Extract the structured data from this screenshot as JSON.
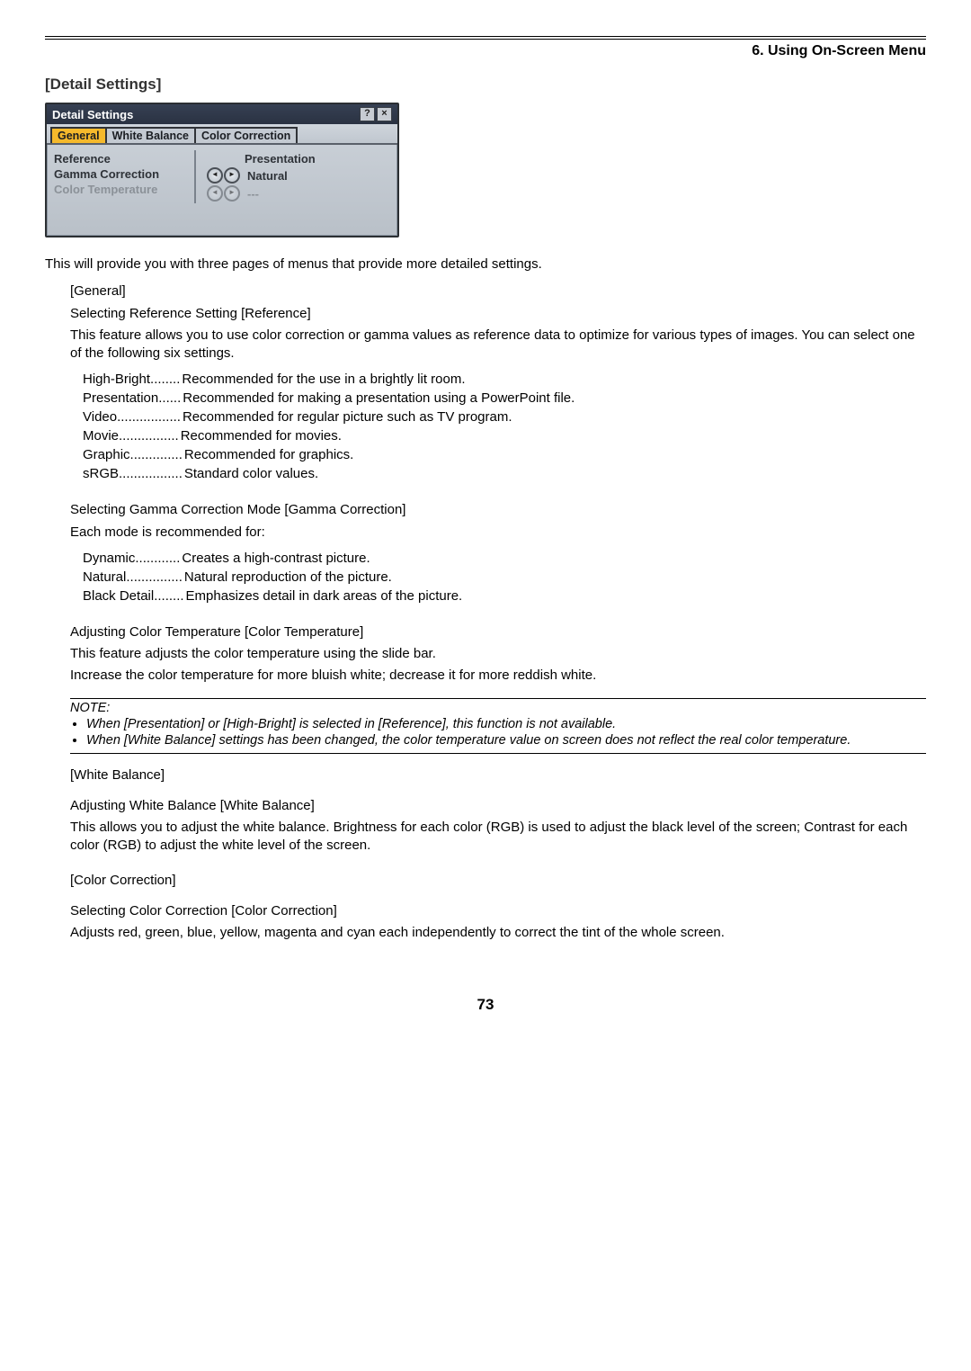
{
  "chapter": "6. Using On-Screen Menu",
  "section_title": "[Detail Settings]",
  "dialog": {
    "title": "Detail Settings",
    "tabs": {
      "general": "General",
      "white_balance": "White Balance",
      "color_correction": "Color Correction"
    },
    "rows": {
      "reference_label": "Reference",
      "reference_value": "Presentation",
      "gamma_label": "Gamma Correction",
      "gamma_value": "Natural",
      "ct_label": "Color Temperature",
      "ct_value": "---"
    }
  },
  "intro": "This will provide you with three pages of menus that provide more detailed settings.",
  "general": {
    "heading": "[General]",
    "ref_title": "Selecting Reference Setting [Reference]",
    "ref_desc": "This feature allows you to use color correction or gamma values as reference data to optimize for various types of images. You can select one of the following six settings.",
    "items": [
      {
        "term": "High-Bright",
        "dots": " ........ ",
        "desc": "Recommended for the use in a brightly lit room."
      },
      {
        "term": "Presentation",
        "dots": " ...... ",
        "desc": "Recommended for making a presentation using a PowerPoint file."
      },
      {
        "term": "Video",
        "dots": " ................. ",
        "desc": "Recommended for regular picture such as TV program."
      },
      {
        "term": "Movie",
        "dots": " ................ ",
        "desc": "Recommended for movies."
      },
      {
        "term": "Graphic",
        "dots": " .............. ",
        "desc": "Recommended for graphics."
      },
      {
        "term": "sRGB",
        "dots": " ................. ",
        "desc": "Standard color values."
      }
    ],
    "gamma_title": "Selecting Gamma Correction Mode [Gamma Correction]",
    "gamma_lead": "Each mode is recommended for:",
    "gamma_items": [
      {
        "term": "Dynamic",
        "dots": " ............ ",
        "desc": "Creates a high-contrast picture."
      },
      {
        "term": "Natural",
        "dots": " ............... ",
        "desc": "Natural reproduction of the picture."
      },
      {
        "term": "Black Detail",
        "dots": " ........ ",
        "desc": "Emphasizes detail in dark areas of the picture."
      }
    ],
    "ct_title": "Adjusting Color Temperature [Color Temperature]",
    "ct_p1": "This feature adjusts the color temperature using the slide bar.",
    "ct_p2": "Increase the color temperature for more bluish white; decrease it for more reddish white."
  },
  "note": {
    "head": "NOTE:",
    "b1": "When [Presentation] or [High-Bright] is selected in [Reference], this function is not available.",
    "b2": "When [White Balance] settings has been changed, the color temperature value on screen does not reflect the real color temperature."
  },
  "wb": {
    "heading": "[White Balance]",
    "title": "Adjusting White Balance [White Balance]",
    "desc": "This allows you to adjust the white balance. Brightness for each color (RGB) is used to adjust the black level of the screen; Contrast for each color (RGB) to adjust the white level of the screen."
  },
  "cc": {
    "heading": "[Color Correction]",
    "title": "Selecting Color Correction [Color Correction]",
    "desc": "Adjusts red, green, blue, yellow, magenta and cyan each independently to correct the tint of the whole screen."
  },
  "page": "73"
}
